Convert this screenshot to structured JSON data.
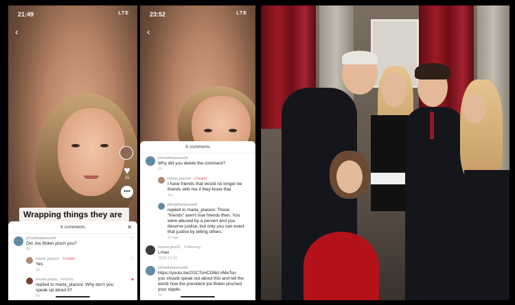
{
  "phone1": {
    "status_time": "21:49",
    "status_signal": "LTE",
    "banner_text": "Wrapping things they are",
    "like_count": "15",
    "sheet_title": "6 comments",
    "comments": [
      {
        "user": "johnathanpessetti",
        "tag": "",
        "text": "Did Joe Biden pinch you?",
        "date": "2h",
        "reply": false
      },
      {
        "user": "maria_piacesi",
        "tag": "· Creator",
        "text": "Yes",
        "date": "1h",
        "reply": true
      },
      {
        "user": "mould.guppy",
        "tag": "· Friends",
        "text": "replied to maria_piacesi: Why don't you speak up about it?",
        "date": "6h",
        "reply": true
      }
    ]
  },
  "phone2": {
    "status_time": "23:52",
    "status_signal": "LTE",
    "sheet_title": "6 comments",
    "comments": [
      {
        "user": "johnathanpessetti",
        "tag": "",
        "text": "Why did you delete the comment?",
        "date": "1h",
        "reply": false
      },
      {
        "user": "maria_piacesi",
        "tag": "· Creator",
        "text": "I have friends that would no longer be friends with me if they knew that",
        "date": "2m",
        "reply": true
      },
      {
        "user": "johnathanpessetti",
        "tag": "",
        "text": "replied to maria_piacesi: Those \"friends\" aren't true friends then. You were abused by a pervert and you deserve justice, but only you can exact that justice by telling others.",
        "date": "1s ago",
        "reply": true
      },
      {
        "user": "noonerytes21",
        "tag": "· Following",
        "text": "Lmao",
        "date": "2020-12-23",
        "reply": false
      },
      {
        "user": "johnathanpessetti",
        "tag": "",
        "text": "https://youtu.be/2GCTsHCD8id #MeToo you should speak out about this and tell the world how the president joe Biden pinched your nipple.",
        "date": "2h",
        "reply": false
      }
    ]
  },
  "colors": {
    "phone_bg": "#3a9ce8",
    "creator_tag": "#e2475d",
    "curtain": "#9c1b26"
  }
}
